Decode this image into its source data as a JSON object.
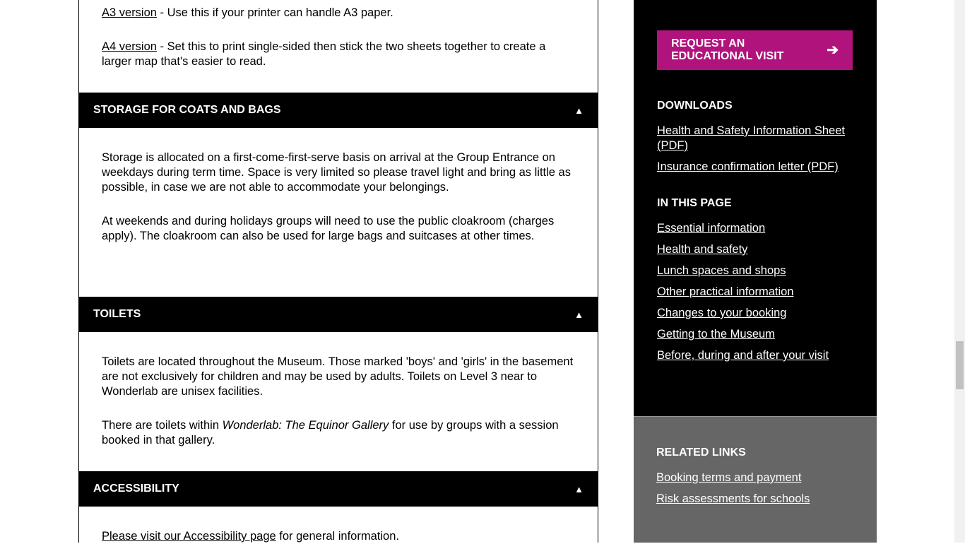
{
  "intro": {
    "a3_link": "A3 version",
    "a3_text": " - Use this if your printer can handle A3 paper.",
    "a4_link": "A4 version",
    "a4_text": " - Set this to print single-sided then stick the two sheets together to create a larger map that's easier to read."
  },
  "sections": [
    {
      "title": "STORAGE FOR COATS AND BAGS",
      "toggle": "▲",
      "p1": "Storage is allocated on a first-come-first-serve basis on arrival at the Group Entrance on weekdays during term time. Space is very limited so please travel light and bring as little as possible, in case we are not able to accommodate your belongings.",
      "p2": "At weekends and during holidays groups will need to use the public cloakroom (charges apply). The cloakroom can also be used for large bags and suitcases at other times."
    },
    {
      "title": "TOILETS",
      "toggle": "▲",
      "p1": "Toilets are located throughout the Museum. Those marked 'boys' and 'girls' in the basement are not exclusively for children and may be used by adults. Toilets on Level 3 near to Wonderlab are unisex facilities.",
      "p2a": "There are toilets within ",
      "p2em": "Wonderlab: The Equinor Gallery",
      "p2b": " for use by groups with a session booked in that gallery."
    },
    {
      "title": "ACCESSIBILITY",
      "toggle": "▲",
      "link": "Please visit our Accessibility page",
      "text": " for general information."
    }
  ],
  "sidebar": {
    "button": "REQUEST AN EDUCATIONAL VISIT",
    "button_color": "#b0137c",
    "downloads_title": "DOWNLOADS",
    "downloads": [
      "Health and Safety Information Sheet (PDF)",
      "Insurance confirmation letter (PDF)"
    ],
    "page_title": "IN THIS PAGE",
    "page_links": [
      "Essential information",
      "Health and safety",
      "Lunch spaces and shops",
      "Other practical information",
      "Changes to your booking",
      "Getting to the Museum",
      "Before, during and after your visit"
    ],
    "related_title": "RELATED LINKS",
    "related": [
      "Booking terms and payment",
      "Risk assessments for schools"
    ]
  }
}
